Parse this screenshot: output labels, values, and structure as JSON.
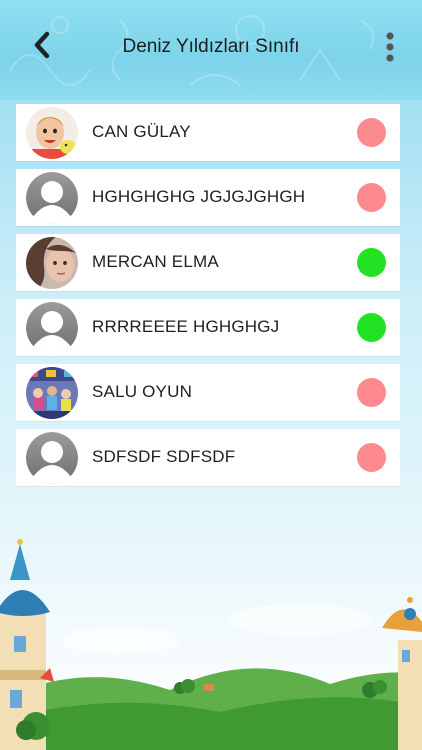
{
  "header": {
    "title": "Deniz Yıldızları Sınıfı",
    "back_icon": "chevron-left-icon",
    "menu_icon": "kebab-menu-icon"
  },
  "students": [
    {
      "name": "CAN GÜLAY",
      "avatar": "photo-boy",
      "status": "absent",
      "status_color": "#fc8a8e"
    },
    {
      "name": "HGHGHGHG JGJGJGHGH",
      "avatar": "default-avatar",
      "status": "absent",
      "status_color": "#fc8a8e"
    },
    {
      "name": "MERCAN ELMA",
      "avatar": "photo-girl",
      "status": "present",
      "status_color": "#22e323"
    },
    {
      "name": "RRRREEEE HGHGHGJ",
      "avatar": "default-avatar",
      "status": "present",
      "status_color": "#22e323"
    },
    {
      "name": "SALU OYUN",
      "avatar": "photo-group",
      "status": "absent",
      "status_color": "#fc8a8e"
    },
    {
      "name": "SDFSDF SDFSDF",
      "avatar": "default-avatar",
      "status": "absent",
      "status_color": "#fc8a8e"
    }
  ]
}
